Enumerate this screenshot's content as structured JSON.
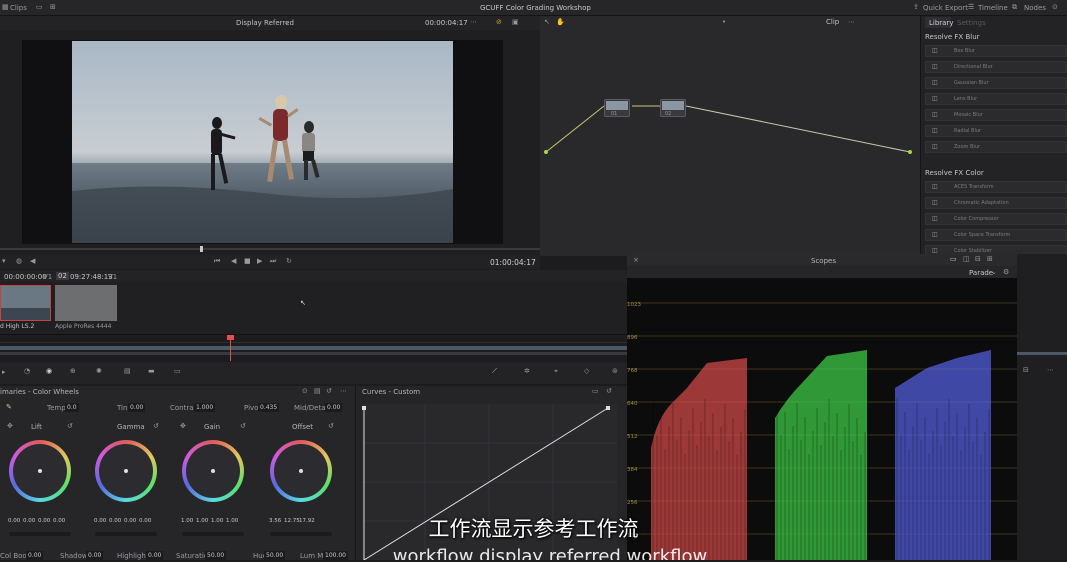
{
  "top_bar": {
    "clips_label": "Clips",
    "project_title": "GCUFF Color Grading Workshop",
    "quick_export": "Quick Export",
    "timeline": "Timeline",
    "nodes": "Nodes"
  },
  "viewer": {
    "display_mode": "Display Referred",
    "timecode_top": "00:00:04:17",
    "timecode_bottom": "01:00:04:17"
  },
  "node_editor": {
    "mode": "Clip",
    "node1_label": "01",
    "node2_label": "02"
  },
  "library": {
    "tab_library": "Library",
    "tab_settings": "Settings",
    "section1": "Resolve FX Blur",
    "items1": [
      "Box Blur",
      "Directional Blur",
      "Gaussian Blur",
      "Lens Blur",
      "Mosaic Blur",
      "Radial Blur",
      "Zoom Blur"
    ],
    "section2": "Resolve FX Color",
    "items2": [
      "ACES Transform",
      "Chromatic Adaptation",
      "Color Compressor",
      "Color Space Transform",
      "Color Stabilizer"
    ]
  },
  "clips": {
    "tc1": "00:00:00:00",
    "v1a": "V1",
    "clip_num": "02",
    "tc2": "09:27:48:13",
    "v1b": "V1",
    "clip1_label": "d High LS.2",
    "clip2_label": "Apple ProRes 4444"
  },
  "color_wheels": {
    "title": "imaries - Color Wheels",
    "temp_label": "Temp",
    "temp_val": "0.0",
    "tint_label": "Tint",
    "tint_val": "0.00",
    "contrast_label": "Contrast",
    "contrast_val": "1.000",
    "pivot_label": "Pivot",
    "pivot_val": "0.435",
    "middetail_label": "Mid/Detail",
    "middetail_val": "0.00",
    "wheels": [
      {
        "name": "Lift",
        "vals": [
          "0.00",
          "0.00",
          "0.00",
          "0.00"
        ]
      },
      {
        "name": "Gamma",
        "vals": [
          "0.00",
          "0.00",
          "0.00",
          "0.00"
        ]
      },
      {
        "name": "Gain",
        "vals": [
          "1.00",
          "1.00",
          "1.00",
          "1.00"
        ]
      },
      {
        "name": "Offset",
        "vals": [
          "3.56",
          "12.75",
          "17.92"
        ]
      }
    ],
    "shadows_label": "Shadows",
    "shadows_val": "0.00",
    "highlights_label": "Highlights",
    "highlights_val": "0.00",
    "saturation_label": "Saturation",
    "saturation_val": "50.00",
    "hue_label": "Hue",
    "hue_val": "50.00",
    "lummix_label": "Lum Mix",
    "lummix_val": "100.00",
    "colboost_label": "Col Boost",
    "colboost_val": "0.00"
  },
  "curves": {
    "title": "Curves - Custom"
  },
  "scopes": {
    "title": "Scopes",
    "mode": "Parade",
    "ticks": [
      "1023",
      "896",
      "768",
      "640",
      "512",
      "384",
      "256",
      "128"
    ],
    "channel_colors": [
      "#d64a4a",
      "#3fcf46",
      "#5560e0"
    ]
  },
  "subtitle": {
    "zh": "工作流显示参考工作流",
    "en": "workflow display referred workflow"
  }
}
